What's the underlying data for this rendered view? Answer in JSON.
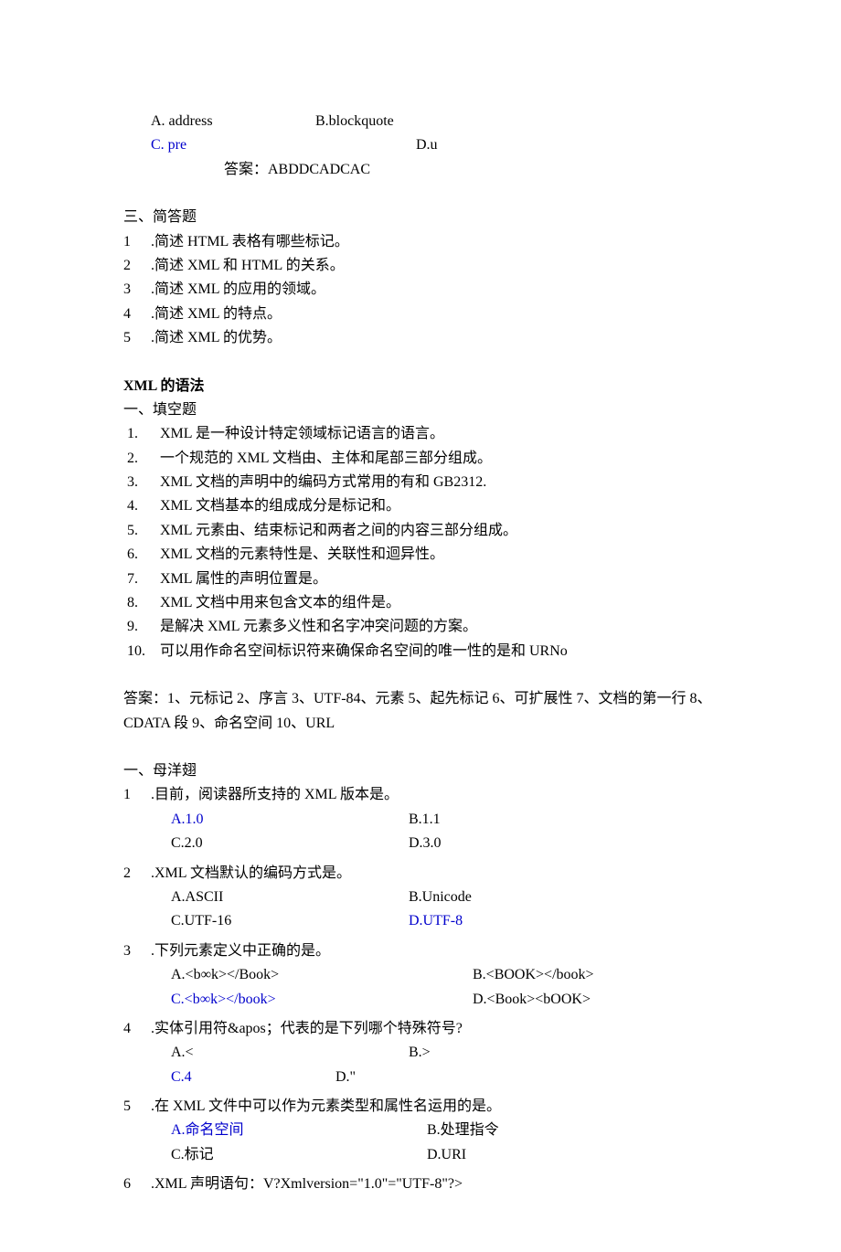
{
  "top_options": {
    "a": "A. address",
    "b": "B.blockquote",
    "c": "C. pre",
    "d": "D.u"
  },
  "answer_top": "答案：ABDDCADCAC",
  "section3": {
    "title": "三、简答题",
    "items": [
      {
        "n": "1",
        "t": ".简述 HTML 表格有哪些标记。"
      },
      {
        "n": "2",
        "t": ".简述 XML 和 HTML 的关系。"
      },
      {
        "n": "3",
        "t": ".简述 XML 的应用的领域。"
      },
      {
        "n": "4",
        "t": ".简述 XML 的特点。"
      },
      {
        "n": "5",
        "t": ".简述 XML 的优势。"
      }
    ]
  },
  "syntax": {
    "title": "XML 的语法",
    "fill_title": "一、填空题",
    "items": [
      {
        "n": "1.",
        "t": "XML 是一种设计特定领域标记语言的语言。"
      },
      {
        "n": "2.",
        "t": "一个规范的 XML 文档由、主体和尾部三部分组成。"
      },
      {
        "n": "3.",
        "t": "XML 文档的声明中的编码方式常用的有和 GB2312."
      },
      {
        "n": "4.",
        "t": "XML 文档基本的组成成分是标记和。"
      },
      {
        "n": "5.",
        "t": "XML 元素由、结束标记和两者之间的内容三部分组成。"
      },
      {
        "n": "6.",
        "t": "XML 文档的元素特性是、关联性和迴异性。"
      },
      {
        "n": "7.",
        "t": "XML 属性的声明位置是。"
      },
      {
        "n": "8.",
        "t": "XML 文档中用来包含文本的组件是。"
      },
      {
        "n": "9.",
        "t": "是解决 XML 元素多义性和名字冲突问题的方案。"
      },
      {
        "n": "10.",
        "t": "可以用作命名空间标识符来确保命名空间的唯一性的是和 URNo"
      }
    ]
  },
  "fill_answer": "答案：1、元标记 2、序言 3、UTF-84、元素 5、起先标记 6、可扩展性 7、文档的第一行 8、CDATA 段 9、命名空间 10、URL",
  "choice": {
    "title": "一、母洋翅",
    "q1": {
      "n": "1",
      "t": ".目前，阅读器所支持的 XML 版本是。",
      "a": "A.1.0",
      "b": "B.1.1",
      "c": "C.2.0",
      "d": "D.3.0"
    },
    "q2": {
      "n": "2",
      "t": ".XML 文档默认的编码方式是。",
      "a": "A.ASCII",
      "b": "B.Unicode",
      "c": "C.UTF-16",
      "d": "D.UTF-8"
    },
    "q3": {
      "n": "3",
      "t": ".下列元素定义中正确的是。",
      "a": "A.<b∞k></Book>",
      "b": "B.<BOOK></book>",
      "c": "C.<b∞k></book>",
      "d": "D.<Book><bOOK>"
    },
    "q4": {
      "n": "4",
      "t": ".实体引用符&apos；代表的是下列哪个特殊符号?",
      "a": "A.<",
      "b": "B.>",
      "c": "C.4",
      "d": "D.\""
    },
    "q5": {
      "n": "5",
      "t": ".在 XML 文件中可以作为元素类型和属性名运用的是。",
      "a": "A.命名空间",
      "b": "B.处理指令",
      "c": "C.标记",
      "d": "D.URI"
    },
    "q6": {
      "n": "6",
      "t": ".XML 声明语句：V?Xmlversion=\"1.0\"=\"UTF-8\"?>"
    }
  }
}
